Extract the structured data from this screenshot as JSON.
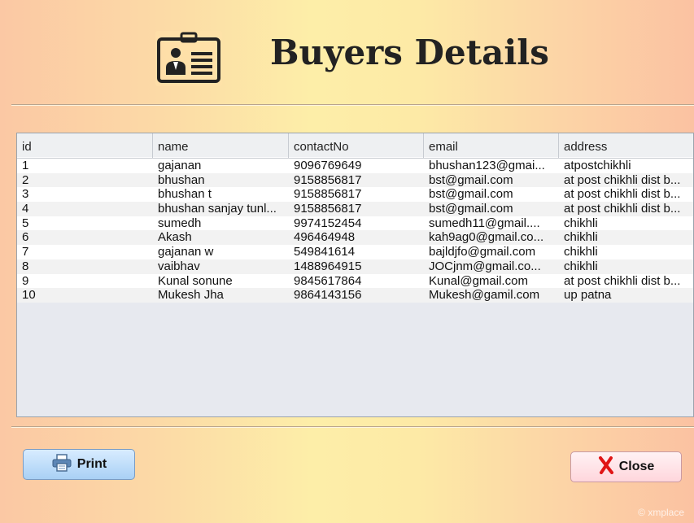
{
  "header": {
    "title": "Buyers Details",
    "icon": "id-badge-icon"
  },
  "table": {
    "columns": [
      "id",
      "name",
      "contactNo",
      "email",
      "address"
    ],
    "rows": [
      [
        "1",
        "gajanan",
        "9096769649",
        "bhushan123@gmai...",
        "atpostchikhli"
      ],
      [
        "2",
        "bhushan",
        "9158856817",
        "bst@gmail.com",
        "at post chikhli dist b..."
      ],
      [
        "3",
        "bhushan t",
        "9158856817",
        "bst@gmail.com",
        "at post chikhli dist b..."
      ],
      [
        "4",
        "bhushan sanjay tunl...",
        "9158856817",
        "bst@gmail.com",
        "at post chikhli dist b..."
      ],
      [
        "5",
        "sumedh",
        "9974152454",
        "sumedh11@gmail....",
        "chikhli"
      ],
      [
        "6",
        "Akash",
        "496464948",
        "kah9ag0@gmail.co...",
        "chikhli"
      ],
      [
        "7",
        "gajanan w",
        "549841614",
        "bajldjfo@gmail.com",
        "chikhli"
      ],
      [
        "8",
        "vaibhav",
        "1488964915",
        "JOCjnm@gmail.co...",
        "chikhli"
      ],
      [
        "9",
        "Kunal sonune",
        "9845617864",
        "Kunal@gmail.com",
        "at post chikhli dist b..."
      ],
      [
        "10",
        "Mukesh Jha",
        "9864143156",
        "Mukesh@gamil.com",
        "up patna"
      ]
    ]
  },
  "buttons": {
    "print_label": "Print",
    "print_icon": "printer-icon",
    "close_label": "Close",
    "close_icon": "close-x-icon"
  },
  "watermark": "© xmplace",
  "colors": {
    "print_bg": "#a9d0f5",
    "close_bg": "#ffd6dc",
    "close_x": "#e01515"
  }
}
